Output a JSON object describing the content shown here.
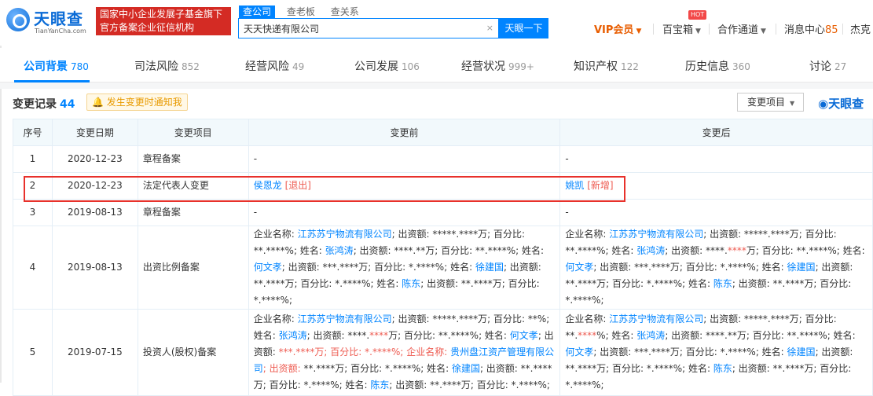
{
  "header": {
    "logo_cn": "天眼查",
    "logo_en": "TianYanCha.com",
    "banner_line1": "国家中小企业发展子基金旗下",
    "banner_line2": "官方备案企业征信机构",
    "search_tabs": [
      "查公司",
      "查老板",
      "查关系"
    ],
    "search_value": "天天快递有限公司",
    "search_clear": "×",
    "search_button": "天眼一下",
    "vip": "VIP会员",
    "baoxiang": "百宝箱",
    "hot": "HOT",
    "hezuo": "合作通道",
    "msg_label": "消息中心",
    "msg_count": "85",
    "user": "杰克"
  },
  "tabs": [
    {
      "label": "公司背景",
      "count": "780"
    },
    {
      "label": "司法风险",
      "count": "852"
    },
    {
      "label": "经营风险",
      "count": "49"
    },
    {
      "label": "公司发展",
      "count": "106"
    },
    {
      "label": "经营状况",
      "count": "999+"
    },
    {
      "label": "知识产权",
      "count": "122"
    },
    {
      "label": "历史信息",
      "count": "360"
    },
    {
      "label": "讨论",
      "count": "27"
    }
  ],
  "section": {
    "title": "变更记录",
    "count": "44",
    "notify": "发生变更时通知我",
    "filter": "变更项目",
    "brand": "天眼查"
  },
  "table": {
    "headers": [
      "序号",
      "变更日期",
      "变更项目",
      "变更前",
      "变更后"
    ],
    "rows": [
      {
        "no": "1",
        "date": "2020-12-23",
        "item": "章程备案",
        "before": "-",
        "after": "-"
      },
      {
        "no": "2",
        "date": "2020-12-23",
        "item": "法定代表人变更",
        "before_name": "侯恩龙",
        "before_tag": "[退出]",
        "after_name": "姚凯",
        "after_tag": "[新增]"
      },
      {
        "no": "3",
        "date": "2019-08-13",
        "item": "章程备案",
        "before": "-",
        "after": "-"
      },
      {
        "no": "4",
        "date": "2019-08-13",
        "item": "出资比例备案"
      },
      {
        "no": "5",
        "date": "2019-07-15",
        "item": "投资人(股权)备案"
      }
    ],
    "row4_before": [
      [
        "t",
        "企业名称: "
      ],
      [
        "l",
        "江苏苏宁物流有限公司"
      ],
      [
        "t",
        "; 出资额: *****.****万; 百分比: **.****%; 姓名: "
      ],
      [
        "l",
        "张鸿涛"
      ],
      [
        "t",
        "; 出资额: ****.**万; 百分比: **.****%; 姓名: "
      ],
      [
        "l",
        "何文孝"
      ],
      [
        "t",
        "; 出资额: ***.****万; 百分比: *.****%; 姓名: "
      ],
      [
        "l",
        "徐建国"
      ],
      [
        "t",
        "; 出资额: **.****万; 百分比: *.****%; 姓名: "
      ],
      [
        "l",
        "陈东"
      ],
      [
        "t",
        "; 出资额: **.****万; 百分比: *.****%;"
      ]
    ],
    "row4_after": [
      [
        "t",
        "企业名称: "
      ],
      [
        "l",
        "江苏苏宁物流有限公司"
      ],
      [
        "t",
        "; 出资额: *****.****万; 百分比: **.****%; 姓名: "
      ],
      [
        "l",
        "张鸿涛"
      ],
      [
        "t",
        "; 出资额: ****."
      ],
      [
        "r",
        "****"
      ],
      [
        "t",
        "万; 百分比: **.****%; 姓名: "
      ],
      [
        "l",
        "何文孝"
      ],
      [
        "t",
        "; 出资额: ***.****万; 百分比: *.****%; 姓名: "
      ],
      [
        "l",
        "徐建国"
      ],
      [
        "t",
        "; 出资额: **.****万; 百分比: *.****%; 姓名: "
      ],
      [
        "l",
        "陈东"
      ],
      [
        "t",
        "; 出资额: **.****万; 百分比: *.****%;"
      ]
    ],
    "row5_before": [
      [
        "t",
        "企业名称: "
      ],
      [
        "l",
        "江苏苏宁物流有限公司"
      ],
      [
        "t",
        "; 出资额: *****.****万; 百分比: **%; 姓名: "
      ],
      [
        "l",
        "张鸿涛"
      ],
      [
        "t",
        "; 出资额: ****."
      ],
      [
        "r",
        "****"
      ],
      [
        "t",
        "万; 百分比: **.****%; 姓名: "
      ],
      [
        "l",
        "何文孝"
      ],
      [
        "t",
        "; 出资额: "
      ],
      [
        "r",
        "***.****万; 百分比: *.****%; 企业名称: "
      ],
      [
        "l",
        "贵州盘江资产管理有限公司"
      ],
      [
        "r",
        "; 出资额: "
      ],
      [
        "t",
        "**.****万; 百分比: *.****%; 姓名: "
      ],
      [
        "l",
        "徐建国"
      ],
      [
        "t",
        "; 出资额: **.****万; 百分比: *.****%; 姓名: "
      ],
      [
        "l",
        "陈东"
      ],
      [
        "t",
        "; 出资额: **.****万; 百分比: *.****%;"
      ]
    ],
    "row5_after": [
      [
        "t",
        "企业名称: "
      ],
      [
        "l",
        "江苏苏宁物流有限公司"
      ],
      [
        "t",
        "; 出资额: *****.****万; 百分比: **."
      ],
      [
        "r",
        "****"
      ],
      [
        "t",
        "%; 姓名: "
      ],
      [
        "l",
        "张鸿涛"
      ],
      [
        "t",
        "; 出资额: ****.**万; 百分比: **.****%; 姓名: "
      ],
      [
        "l",
        "何文孝"
      ],
      [
        "t",
        "; 出资额: ***.****万; 百分比: *.****%; 姓名: "
      ],
      [
        "l",
        "徐建国"
      ],
      [
        "t",
        "; 出资额: **.****万; 百分比: *.****%; 姓名: "
      ],
      [
        "l",
        "陈东"
      ],
      [
        "t",
        "; 出资额: **.****万; 百分比: *.****%;"
      ]
    ]
  }
}
